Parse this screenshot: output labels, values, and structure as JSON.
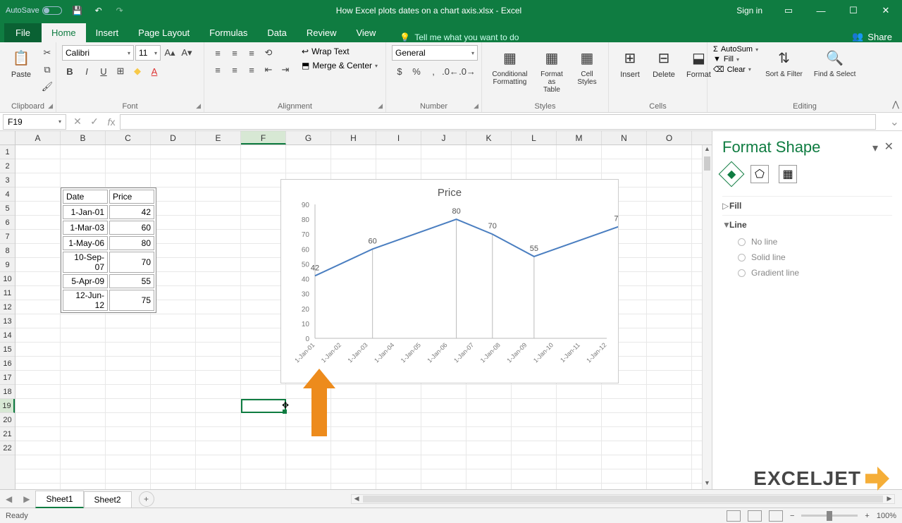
{
  "app": {
    "autosave_label": "AutoSave",
    "autosave_state": "Off",
    "title": "How Excel plots dates on a chart axis.xlsx - Excel",
    "signin": "Sign in",
    "share": "Share"
  },
  "tabs": {
    "file": "File",
    "home": "Home",
    "insert": "Insert",
    "page_layout": "Page Layout",
    "formulas": "Formulas",
    "data": "Data",
    "review": "Review",
    "view": "View",
    "tell_me": "Tell me what you want to do"
  },
  "ribbon": {
    "clipboard": {
      "label": "Clipboard",
      "paste": "Paste"
    },
    "font": {
      "label": "Font",
      "name": "Calibri",
      "size": "11",
      "bold": "B",
      "italic": "I",
      "underline": "U"
    },
    "alignment": {
      "label": "Alignment",
      "wrap": "Wrap Text",
      "merge": "Merge & Center"
    },
    "number": {
      "label": "Number",
      "format": "General"
    },
    "styles": {
      "label": "Styles",
      "cond": "Conditional Formatting",
      "table": "Format as Table",
      "cell": "Cell Styles"
    },
    "cells": {
      "label": "Cells",
      "insert": "Insert",
      "delete": "Delete",
      "format": "Format"
    },
    "editing": {
      "label": "Editing",
      "autosum": "AutoSum",
      "fill": "Fill",
      "clear": "Clear",
      "sort": "Sort & Filter",
      "find": "Find & Select"
    }
  },
  "formula_bar": {
    "cell_ref": "F19",
    "formula": ""
  },
  "columns": [
    "A",
    "B",
    "C",
    "D",
    "E",
    "F",
    "G",
    "H",
    "I",
    "J",
    "K",
    "L",
    "M",
    "N",
    "O"
  ],
  "rows_visible": 22,
  "selected_col": "F",
  "selected_row": 19,
  "table": {
    "headers": [
      "Date",
      "Price"
    ],
    "rows": [
      [
        "1-Jan-01",
        42
      ],
      [
        "1-Mar-03",
        60
      ],
      [
        "1-May-06",
        80
      ],
      [
        "10-Sep-07",
        70
      ],
      [
        "5-Apr-09",
        55
      ],
      [
        "12-Jun-12",
        75
      ]
    ]
  },
  "chart_data": {
    "type": "line",
    "title": "Price",
    "ylabel": "",
    "ylim": [
      0,
      90
    ],
    "y_ticks": [
      0,
      10,
      20,
      30,
      40,
      50,
      60,
      70,
      80,
      90
    ],
    "x_ticks": [
      "1-Jan-01",
      "1-Jan-02",
      "1-Jan-03",
      "1-Jan-04",
      "1-Jan-05",
      "1-Jan-06",
      "1-Jan-07",
      "1-Jan-08",
      "1-Jan-09",
      "1-Jan-10",
      "1-Jan-11",
      "1-Jan-12"
    ],
    "series": [
      {
        "name": "Price",
        "x": [
          "1-Jan-01",
          "1-Mar-03",
          "1-May-06",
          "10-Sep-07",
          "5-Apr-09",
          "12-Jun-12"
        ],
        "values": [
          42,
          60,
          80,
          70,
          55,
          75
        ],
        "x_units": [
          0.0,
          2.17,
          5.33,
          6.69,
          8.26,
          11.44
        ]
      }
    ]
  },
  "format_pane": {
    "title": "Format Shape",
    "sections": {
      "fill": "Fill",
      "line": "Line"
    },
    "line_options": {
      "none": "No line",
      "solid": "Solid line",
      "gradient": "Gradient line"
    }
  },
  "sheet_tabs": [
    "Sheet1",
    "Sheet2"
  ],
  "active_sheet": "Sheet1",
  "status": {
    "ready": "Ready",
    "zoom": "100%"
  },
  "logo": "EXCELJET"
}
